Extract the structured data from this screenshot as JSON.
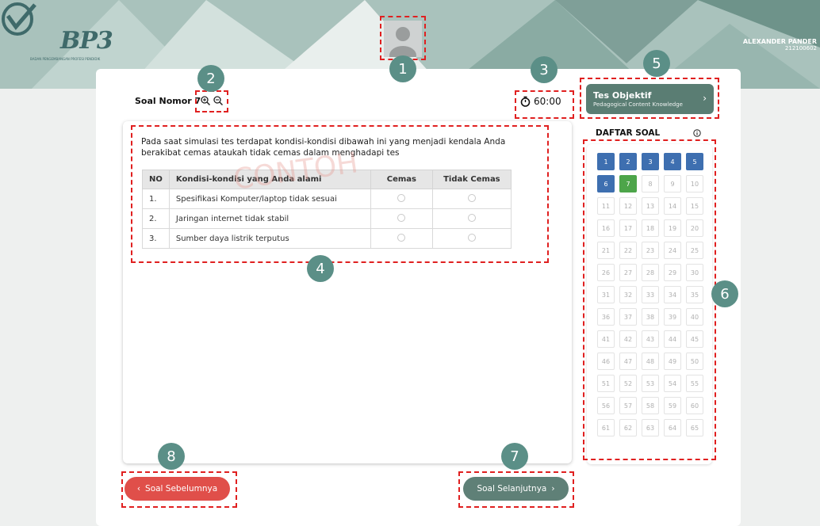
{
  "header": {
    "logo_text": "BP3",
    "logo_subtitle": "BADAN PENGEMBANGAN PROFESI PENDIDIK",
    "user_name": "ALEXANDER PANDER",
    "user_id": "212100602"
  },
  "question": {
    "label": "Soal Nomor 7",
    "text": "Pada saat simulasi tes terdapat kondisi-kondisi dibawah ini yang menjadi kendala Anda berakibat cemas ataukah tidak cemas dalam menghadapi tes",
    "watermark": "CONTOH",
    "table": {
      "headers": [
        "NO",
        "Kondisi-kondisi yang Anda alami",
        "Cemas",
        "Tidak Cemas"
      ],
      "rows": [
        {
          "no": "1.",
          "text": "Spesifikasi Komputer/laptop tidak sesuai"
        },
        {
          "no": "2.",
          "text": "Jaringan internet tidak stabil"
        },
        {
          "no": "3.",
          "text": "Sumber daya listrik terputus"
        }
      ]
    }
  },
  "timer": "60:00",
  "section": {
    "title": "Tes Objektif",
    "subtitle": "Pedagogical Content Knowledge"
  },
  "daftar_soal": {
    "title": "DAFTAR SOAL",
    "numbers": [
      "1",
      "2",
      "3",
      "4",
      "5",
      "6",
      "7",
      "8",
      "9",
      "10",
      "11",
      "12",
      "13",
      "14",
      "15",
      "16",
      "17",
      "18",
      "19",
      "20",
      "21",
      "22",
      "23",
      "24",
      "25",
      "26",
      "27",
      "28",
      "29",
      "30",
      "31",
      "32",
      "33",
      "34",
      "35",
      "36",
      "37",
      "38",
      "39",
      "40",
      "41",
      "42",
      "43",
      "44",
      "45",
      "46",
      "47",
      "48",
      "49",
      "50",
      "51",
      "52",
      "53",
      "54",
      "55",
      "56",
      "57",
      "58",
      "59",
      "60",
      "61",
      "62",
      "63",
      "64",
      "65"
    ],
    "answered": [
      "1",
      "2",
      "3",
      "4",
      "5",
      "6"
    ],
    "current": "7"
  },
  "nav": {
    "prev_label": "Soal Sebelumnya",
    "next_label": "Soal Selanjutnya"
  },
  "callouts": [
    "1",
    "2",
    "3",
    "4",
    "5",
    "6",
    "7",
    "8"
  ],
  "colors": {
    "primary": "#5a7d73",
    "answered": "#3e6fb0",
    "current": "#4da54a",
    "prev_button": "#e04f4a",
    "annotation": "#e02020"
  }
}
